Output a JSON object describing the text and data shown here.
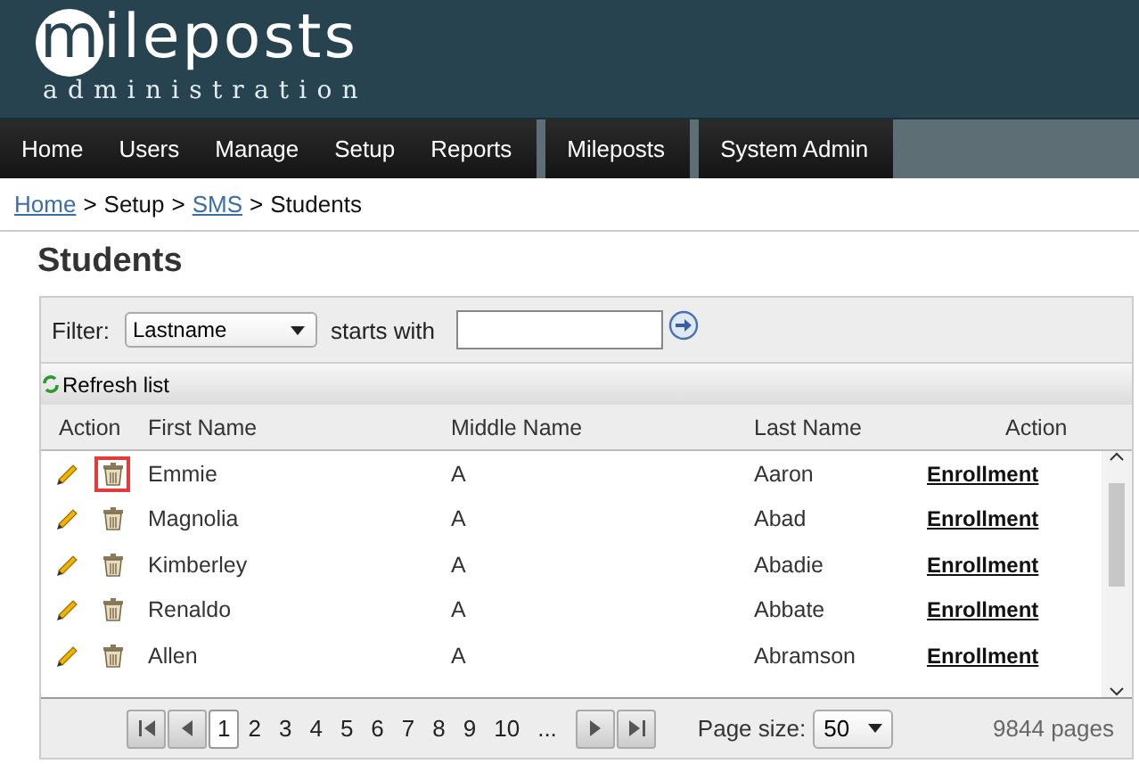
{
  "logo": {
    "letter": "m",
    "rest": "ileposts",
    "subtitle": "administration"
  },
  "nav": [
    {
      "group": [
        {
          "label": "Home"
        },
        {
          "label": "Users"
        },
        {
          "label": "Manage"
        },
        {
          "label": "Setup"
        },
        {
          "label": "Reports"
        }
      ]
    },
    {
      "group": [
        {
          "label": "Mileposts"
        }
      ]
    },
    {
      "group": [
        {
          "label": "System Admin"
        }
      ]
    }
  ],
  "breadcrumb": [
    {
      "label": "Home",
      "link": true
    },
    {
      "label": "Setup",
      "link": false
    },
    {
      "label": "SMS",
      "link": true
    },
    {
      "label": "Students",
      "link": false
    }
  ],
  "breadcrumb_separator": ">",
  "title": "Students",
  "filter": {
    "label": "Filter:",
    "field": "Lastname",
    "condition": "starts with"
  },
  "refresh": "Refresh list",
  "columns": [
    "Action",
    "First Name",
    "Middle Name",
    "Last Name",
    "Action"
  ],
  "rows": [
    {
      "first": "Emmie",
      "middle": "A",
      "last": "Aaron",
      "link": "Enrollment",
      "highlighted": true
    },
    {
      "first": "Magnolia",
      "middle": "A",
      "last": "Abad",
      "link": "Enrollment",
      "highlighted": false
    },
    {
      "first": "Kimberley",
      "middle": "A",
      "last": "Abadie",
      "link": "Enrollment",
      "highlighted": false
    },
    {
      "first": "Renaldo",
      "middle": "A",
      "last": "Abbate",
      "link": "Enrollment",
      "highlighted": false
    },
    {
      "first": "Allen",
      "middle": "A",
      "last": "Abramson",
      "link": "Enrollment",
      "highlighted": false
    }
  ],
  "pager": {
    "pages": [
      {
        "label": "1",
        "selected": true
      },
      {
        "label": "2",
        "selected": false
      },
      {
        "label": "3",
        "selected": false
      },
      {
        "label": "4",
        "selected": false
      },
      {
        "label": "5",
        "selected": false
      },
      {
        "label": "6",
        "selected": false
      },
      {
        "label": "7",
        "selected": false
      },
      {
        "label": "8",
        "selected": false
      },
      {
        "label": "9",
        "selected": false
      },
      {
        "label": "10",
        "selected": false
      },
      {
        "label": "...",
        "selected": false
      }
    ],
    "page_size_label": "Page size:",
    "page_size": "50",
    "total": "9844 pages"
  }
}
